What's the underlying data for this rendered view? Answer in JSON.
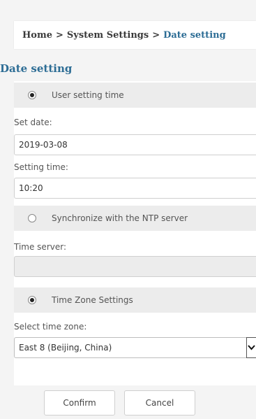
{
  "breadcrumb": {
    "home": "Home",
    "separator": ">",
    "system_settings": "System Settings",
    "current": "Date setting"
  },
  "page_title": "Date setting",
  "user_time_section": {
    "label": "User setting time",
    "selected": true,
    "set_date_label": "Set date:",
    "set_date_value": "2019-03-08",
    "setting_time_label": "Setting time:",
    "setting_time_value": "10:20"
  },
  "ntp_section": {
    "label": "Synchronize with the NTP server",
    "selected": false,
    "time_server_label": "Time server:",
    "time_server_value": ""
  },
  "timezone_section": {
    "label": "Time Zone Settings",
    "selected": true,
    "select_label": "Select time zone:",
    "selected_zone": "East 8 (Beijing, China)"
  },
  "buttons": {
    "confirm": "Confirm",
    "cancel": "Cancel"
  },
  "colors": {
    "accent": "#2d6d95",
    "section_bg": "#ececec",
    "page_bg": "#f4f4f4"
  }
}
